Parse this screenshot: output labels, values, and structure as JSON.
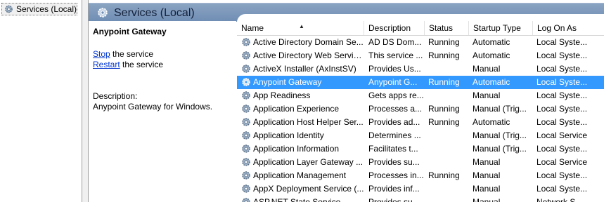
{
  "tree": {
    "label": "Services (Local)"
  },
  "banner": {
    "title": "Services (Local)"
  },
  "details": {
    "service_name": "Anypoint Gateway",
    "stop_link": "Stop",
    "stop_rest": " the service",
    "restart_link": "Restart",
    "restart_rest": " the service",
    "description_label": "Description:",
    "description_text": "Anypoint Gateway for Windows."
  },
  "columns": {
    "name": "Name",
    "description": "Description",
    "status": "Status",
    "startup": "Startup Type",
    "logon": "Log On As"
  },
  "services": [
    {
      "name": "Active Directory Domain Se...",
      "description": "AD DS Dom...",
      "status": "Running",
      "startup": "Automatic",
      "logon": "Local Syste..."
    },
    {
      "name": "Active Directory Web Services",
      "description": "This service ...",
      "status": "Running",
      "startup": "Automatic",
      "logon": "Local Syste..."
    },
    {
      "name": "ActiveX Installer (AxInstSV)",
      "description": "Provides Us...",
      "status": "",
      "startup": "Manual",
      "logon": "Local Syste..."
    },
    {
      "name": "Anypoint Gateway",
      "description": "Anypoint G...",
      "status": "Running",
      "startup": "Automatic",
      "logon": "Local Syste..."
    },
    {
      "name": "App Readiness",
      "description": "Gets apps re...",
      "status": "",
      "startup": "Manual",
      "logon": "Local Syste..."
    },
    {
      "name": "Application Experience",
      "description": "Processes a...",
      "status": "Running",
      "startup": "Manual (Trig...",
      "logon": "Local Syste..."
    },
    {
      "name": "Application Host Helper Ser...",
      "description": "Provides ad...",
      "status": "Running",
      "startup": "Automatic",
      "logon": "Local Syste..."
    },
    {
      "name": "Application Identity",
      "description": "Determines ...",
      "status": "",
      "startup": "Manual (Trig...",
      "logon": "Local Service"
    },
    {
      "name": "Application Information",
      "description": "Facilitates t...",
      "status": "",
      "startup": "Manual (Trig...",
      "logon": "Local Syste..."
    },
    {
      "name": "Application Layer Gateway ...",
      "description": "Provides su...",
      "status": "",
      "startup": "Manual",
      "logon": "Local Service"
    },
    {
      "name": "Application Management",
      "description": "Processes in...",
      "status": "Running",
      "startup": "Manual",
      "logon": "Local Syste..."
    },
    {
      "name": "AppX Deployment Service (...",
      "description": "Provides inf...",
      "status": "",
      "startup": "Manual",
      "logon": "Local Syste..."
    },
    {
      "name": "ASP.NET State Service",
      "description": "Provides su...",
      "status": "",
      "startup": "Manual",
      "logon": "Network S..."
    }
  ],
  "selected_index": 3,
  "colors": {
    "selection": "#3399ff",
    "link": "#0033cc",
    "banner": "#7b96ba"
  },
  "icons": {
    "service": "gear-icon",
    "sort": "sort-ascending-icon"
  }
}
